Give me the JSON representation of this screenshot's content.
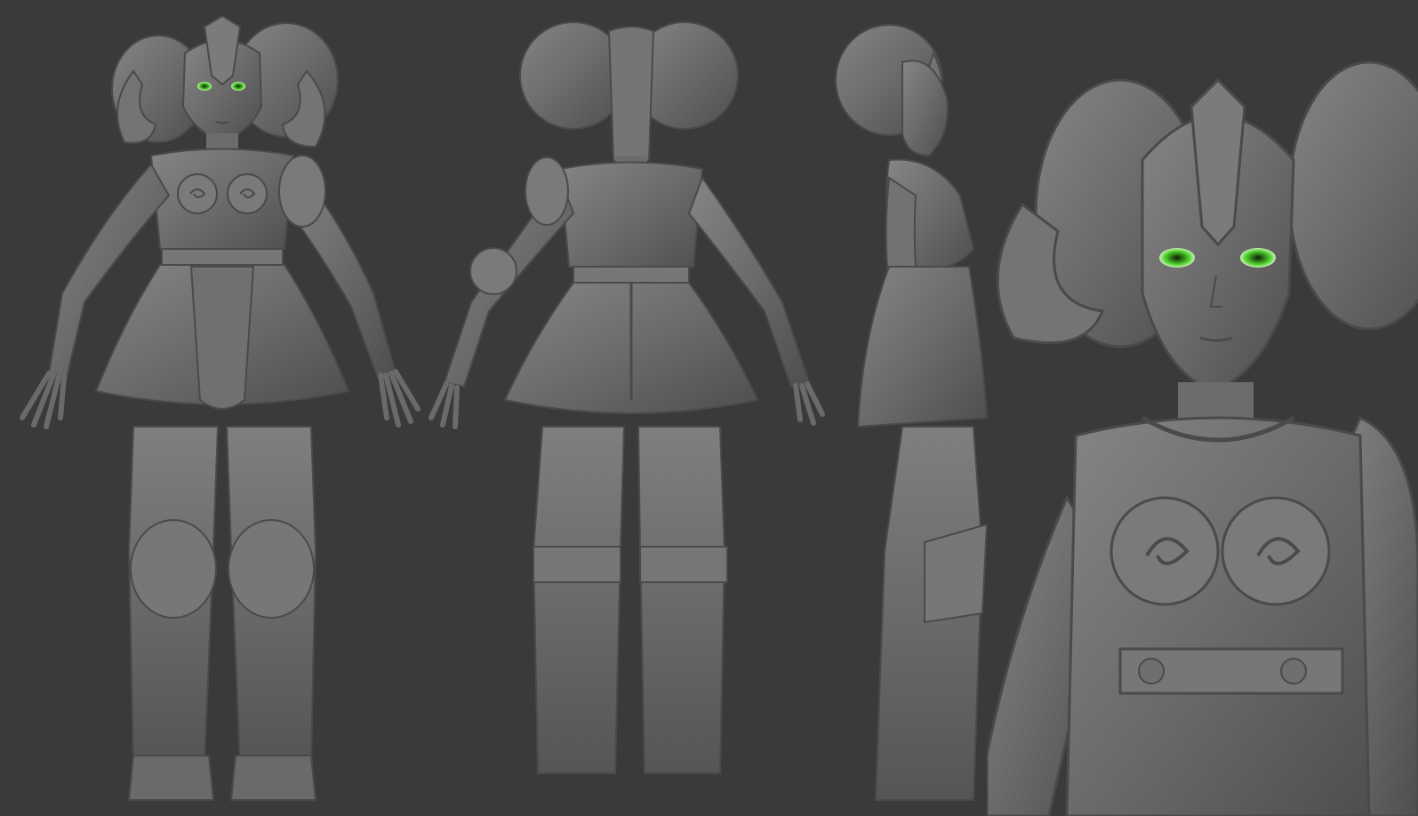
{
  "scene": {
    "background": "#3a3a3c",
    "clay_color": "#6e6e6e",
    "clay_shadow": "#4f4f50",
    "clay_highlight": "#8a8a8a",
    "eye_color": "#4fd12e"
  },
  "views": [
    {
      "name": "front"
    },
    {
      "name": "back"
    },
    {
      "name": "side"
    },
    {
      "name": "closeup"
    }
  ]
}
